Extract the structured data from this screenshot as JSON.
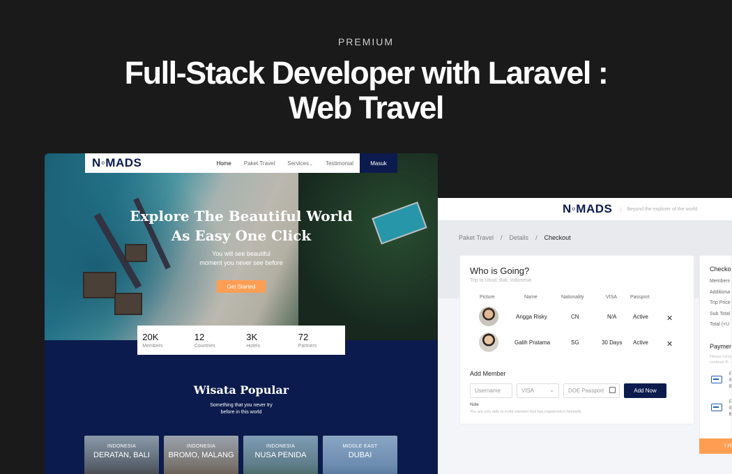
{
  "header": {
    "eyebrow": "PREMIUM",
    "title_line1": "Full-Stack Developer with Laravel :",
    "title_line2": "Web Travel"
  },
  "landing": {
    "logo": "N◦MADS",
    "nav": [
      "Home",
      "Paket Travel",
      "Services",
      "Testimonial"
    ],
    "login_label": "Masuk",
    "hero_title_line1": "Explore The Beautiful World",
    "hero_title_line2": "As Easy One Click",
    "hero_sub_line1": "You will see beautiful",
    "hero_sub_line2": "moment you never see before",
    "cta_label": "Get Started",
    "stats": [
      {
        "value": "20K",
        "label": "Members"
      },
      {
        "value": "12",
        "label": "Countries"
      },
      {
        "value": "3K",
        "label": "Hotels"
      },
      {
        "value": "72",
        "label": "Partners"
      }
    ],
    "popular_title": "Wisata Popular",
    "popular_sub_line1": "Something that you never try",
    "popular_sub_line2": "before in this world",
    "destinations": [
      {
        "country": "INDONESIA",
        "place": "DERATAN, BALI"
      },
      {
        "country": "INDONESIA",
        "place": "BROMO, MALANG"
      },
      {
        "country": "INDONESIA",
        "place": "NUSA PENIDA"
      },
      {
        "country": "MIDDLE EAST",
        "place": "DUBAI"
      }
    ]
  },
  "checkout": {
    "logo": "N◦MADS",
    "tagline": "Beyond the explorer of the world",
    "breadcrumb": [
      "Paket Travel",
      "Details",
      "Checkout"
    ],
    "panel_title": "Who is Going?",
    "trip": "Trip to Ubud, Bali, Indonesia",
    "columns": [
      "Picture",
      "Name",
      "Nationality",
      "VISA",
      "Passport"
    ],
    "members": [
      {
        "name": "Angga Risky",
        "nationality": "CN",
        "visa": "N/A",
        "passport": "Active"
      },
      {
        "name": "Galih Pratama",
        "nationality": "SG",
        "visa": "30 Days",
        "passport": "Active"
      }
    ],
    "add_member_label": "Add Member",
    "username_placeholder": "Username",
    "visa_select": "VISA",
    "passport_placeholder": "DOE Passport",
    "add_now_label": "Add Now",
    "note_label": "Note",
    "note_text": "You are only able to invite member that has registered in Nomads.",
    "side": {
      "title": "Checkou",
      "rows": [
        "Members",
        "Additiona",
        "Trip Price",
        "Sub Total",
        "Total (+U"
      ],
      "payment_title": "Paymen",
      "payment_note_line1": "Please comp",
      "payment_note_line2": "continue th",
      "bank1_line1": "P",
      "bank1_line2": "08",
      "bank1_line3": "Ba",
      "bank2_line1": "P",
      "bank2_line2": "08",
      "bank2_line3": "Ba",
      "button_label": "I H"
    }
  },
  "colors": {
    "navy": "#0c1b4d",
    "orange": "#ff9e53",
    "bg": "#1a1a1a"
  }
}
